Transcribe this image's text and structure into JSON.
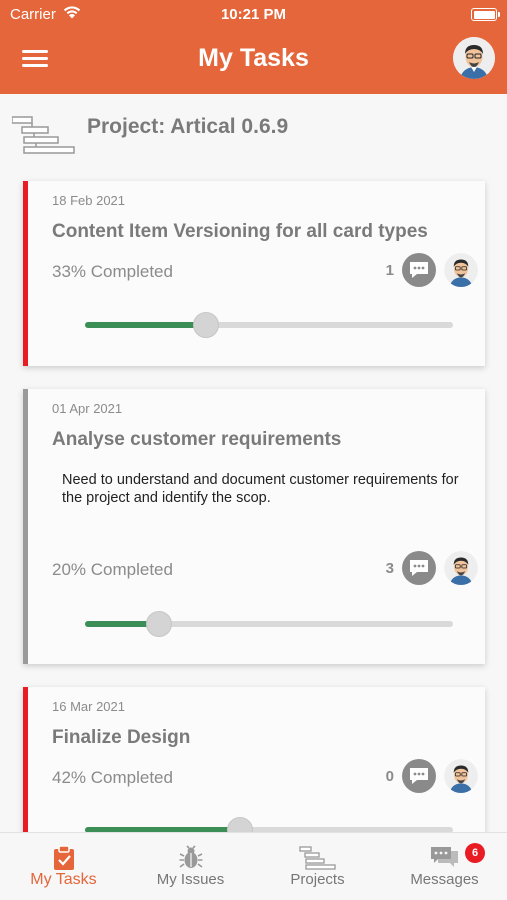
{
  "status_bar": {
    "carrier": "Carrier",
    "time": "10:21 PM"
  },
  "header": {
    "title": "My Tasks"
  },
  "project": {
    "title": "Project: Artical 0.6.9"
  },
  "tasks": [
    {
      "date": "18 Feb 2021",
      "title": "Content Item Versioning for all card types",
      "description": "",
      "progress_text": "33% Completed",
      "progress": 0.33,
      "comment_count": "1",
      "priority_color": "#e91c24"
    },
    {
      "date": "01 Apr 2021",
      "title": "Analyse customer requirements",
      "description": "Need to understand and document customer requirements for the project and identify the scop.",
      "progress_text": "20% Completed",
      "progress": 0.2,
      "comment_count": "3",
      "priority_color": "#9a9a9a"
    },
    {
      "date": "16 Mar 2021",
      "title": "Finalize Design",
      "description": "",
      "progress_text": "42% Completed",
      "progress": 0.42,
      "comment_count": "0",
      "priority_color": "#e91c24"
    }
  ],
  "tabbar": {
    "tabs": [
      {
        "label": "My Tasks",
        "icon": "clipboard-check-icon",
        "active": true
      },
      {
        "label": "My Issues",
        "icon": "bug-icon",
        "active": false
      },
      {
        "label": "Projects",
        "icon": "gantt-icon",
        "active": false
      },
      {
        "label": "Messages",
        "icon": "chat-icon",
        "active": false
      }
    ],
    "messages_badge": "6"
  },
  "colors": {
    "accent": "#e4663a",
    "progress": "#3c8e57",
    "high_priority": "#e91c24",
    "normal_priority": "#9a9a9a",
    "badge": "#e91c24"
  }
}
